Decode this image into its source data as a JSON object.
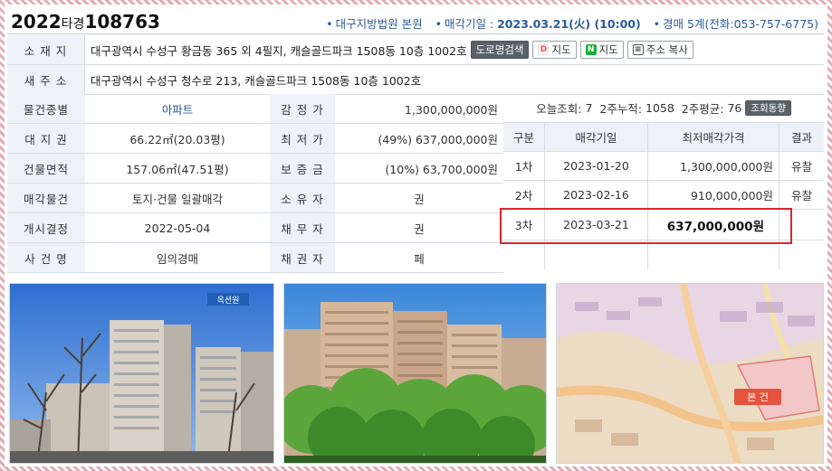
{
  "header": {
    "case_prefix": "2022",
    "case_mid": "타경",
    "case_num": "108763",
    "court": "대구지방법원 본원",
    "sale_date_label": "매각기일 : ",
    "sale_date": "2023.03.21(火) (10:00)",
    "dept": "경매 5계",
    "phone": "(전화:053-757-6775)"
  },
  "address": {
    "label": "소 재 지",
    "value": "대구광역시 수성구 황금동 365 외 4필지, 캐슬골드파크 1508동 10층 1002호",
    "btn_road": "도로명검색",
    "btn_daum_map": "지도",
    "btn_naver_map": "지도",
    "btn_copy": "주소 복사"
  },
  "new_address": {
    "label": "새 주 소",
    "value": "대구광역시 수성구 청수로 213, 캐슬골드파크 1508동 10층 1002호"
  },
  "info": {
    "type_label": "물건종별",
    "type_value": "아파트",
    "appraisal_label": "감 정 가",
    "appraisal_value": "1,300,000,000원",
    "land_label": "대 지 권",
    "land_value": "66.22㎡(20.03평)",
    "min_label": "최 저 가",
    "min_value": "(49%) 637,000,000원",
    "bldg_label": "건물면적",
    "bldg_value": "157.06㎡(47.51평)",
    "deposit_label": "보 증 금",
    "deposit_value": "(10%) 63,700,000원",
    "sale_item_label": "매각물건",
    "sale_item_value": "토지·건물 일괄매각",
    "owner_label": "소 유 자",
    "owner_value": "권",
    "start_label": "개시결정",
    "start_value": "2022-05-04",
    "debtor_label": "채 무 자",
    "debtor_value": "권",
    "case_label": "사 건 명",
    "case_value": "임의경매",
    "creditor_label": "채 권 자",
    "creditor_value": "페"
  },
  "views": {
    "today_label": "오늘조회:",
    "today": "7",
    "two_week_label": "2주누적:",
    "two_week": "1058",
    "avg_label": "2주평균:",
    "avg": "76",
    "trend_btn": "조회동향"
  },
  "history": {
    "headers": [
      "구분",
      "매각기일",
      "최저매각가격",
      "결과"
    ],
    "rows": [
      {
        "round": "1차",
        "date": "2023-01-20",
        "price": "1,300,000,000원",
        "result": "유찰"
      },
      {
        "round": "2차",
        "date": "2023-02-16",
        "price": "910,000,000원",
        "result": "유찰"
      },
      {
        "round": "3차",
        "date": "2023-03-21",
        "price": "637,000,000원",
        "result": ""
      }
    ]
  },
  "photos": {
    "watermark": "옥션원",
    "map_label": "본 건"
  },
  "colors": {
    "label_bg": "#eef2f8",
    "accent": "#2b5a9a",
    "highlight": "#d8282c"
  }
}
